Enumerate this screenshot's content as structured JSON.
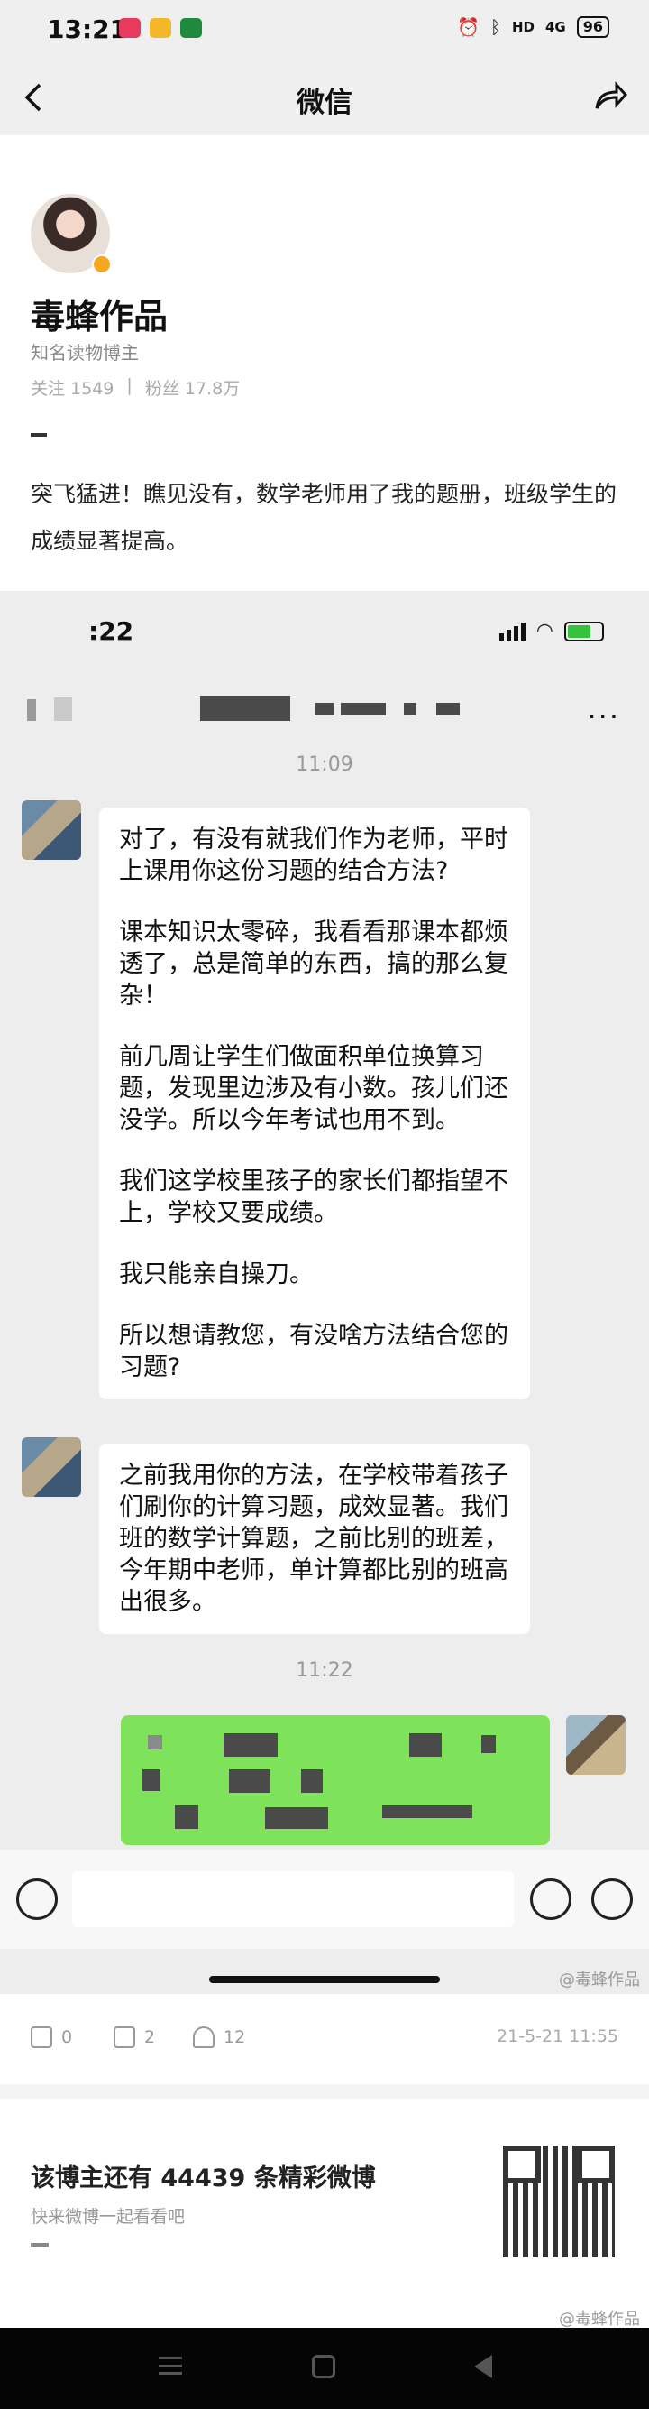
{
  "status_bar": {
    "time": "13:21",
    "signal": "4G",
    "battery": "96"
  },
  "nav": {
    "title": "微信",
    "back_icon": "chevron-left-icon",
    "share_icon": "share-icon"
  },
  "profile": {
    "name": "毒蜂作品",
    "role": "知名读物博主",
    "follow": "关注 1549",
    "fans": "粉丝 17.8万",
    "post_text": "突飞猛进！瞧见没有，数学老师用了我的题册，班级学生的成绩显著提高。"
  },
  "screenshot": {
    "time": ":22",
    "time1": "11:09",
    "message1": [
      "对了，有没有就我们作为老师，平时上课用你这份习题的结合方法?",
      "课本知识太零碎，我看看那课本都烦透了，总是简单的东西，搞的那么复杂！",
      "前几周让学生们做面积单位换算习题，发现里边涉及有小数。孩儿们还没学。所以今年考试也用不到。",
      "我们这学校里孩子的家长们都指望不上，学校又要成绩。",
      "我只能亲自操刀。",
      "所以想请教您，有没啥方法结合您的习题?"
    ],
    "message2": "之前我用你的方法，在学校带着孩子们刷你的计算习题，成效显著。我们班的数学计算题，之前比别的班差，今年期中老师，单计算都比别的班高出很多。",
    "time2": "11:22",
    "watermark": "@毒蜂作品"
  },
  "actions": {
    "share": "0",
    "comment": "2",
    "like": "12",
    "date": "21-5-21 11:55"
  },
  "promo": {
    "title": "该博主还有 44439 条精彩微博",
    "subtitle": "快来微博一起看看吧",
    "watermark": "@毒蜂作品"
  }
}
